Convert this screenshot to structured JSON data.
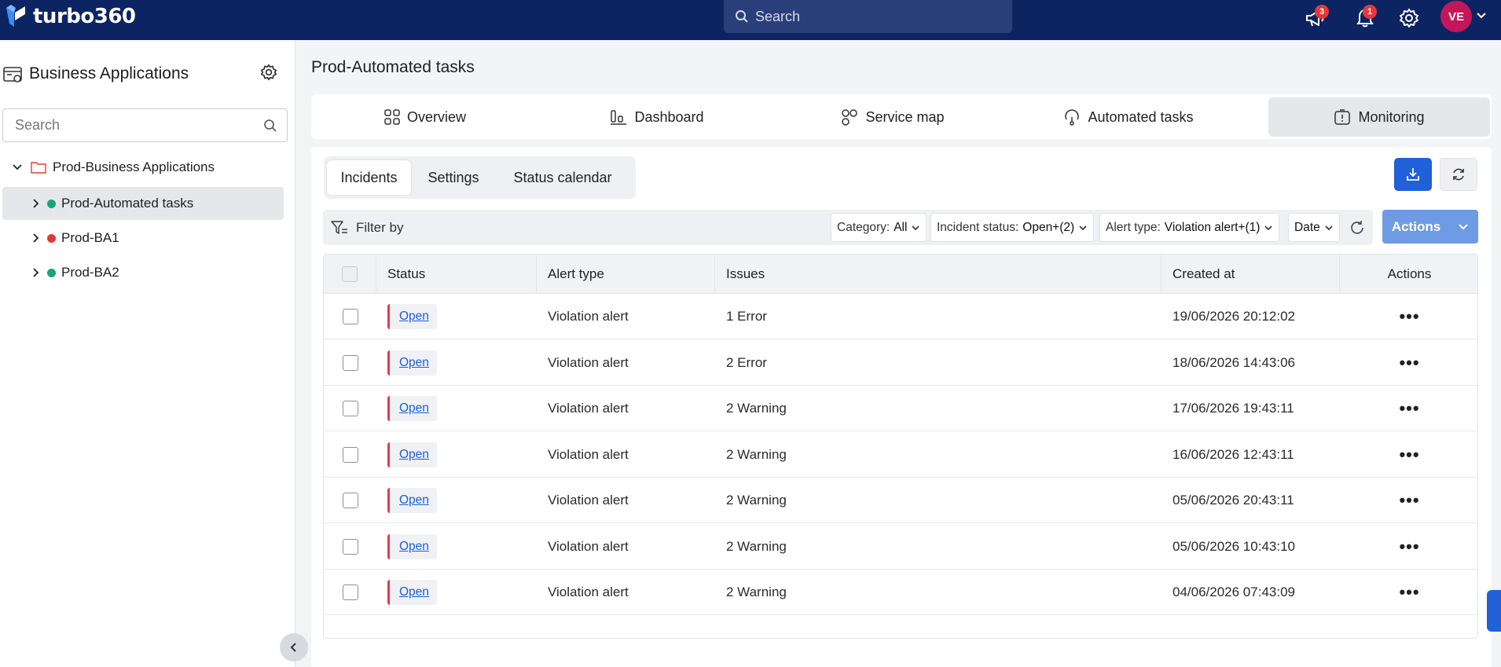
{
  "brand": {
    "name": "turbo360"
  },
  "topbar": {
    "search_placeholder": "Search",
    "announcements_count": "3",
    "notifications_count": "1",
    "user_initials": "VE"
  },
  "sidebar": {
    "title": "Business Applications",
    "search_placeholder": "Search",
    "tree": {
      "root": {
        "label": "Prod-Business Applications"
      },
      "children": [
        {
          "label": "Prod-Automated tasks",
          "status_color": "#1aa37a",
          "selected": true
        },
        {
          "label": "Prod-BA1",
          "status_color": "#e53935",
          "selected": false
        },
        {
          "label": "Prod-BA2",
          "status_color": "#1aa37a",
          "selected": false
        }
      ]
    }
  },
  "page": {
    "title": "Prod-Automated tasks"
  },
  "tabs": [
    {
      "label": "Overview",
      "icon": "grid-icon"
    },
    {
      "label": "Dashboard",
      "icon": "dashboard-icon"
    },
    {
      "label": "Service map",
      "icon": "service-map-icon"
    },
    {
      "label": "Automated tasks",
      "icon": "automated-tasks-icon"
    },
    {
      "label": "Monitoring",
      "icon": "monitoring-icon",
      "active": true
    }
  ],
  "subtabs": [
    {
      "label": "Incidents",
      "active": true
    },
    {
      "label": "Settings"
    },
    {
      "label": "Status calendar"
    }
  ],
  "filter": {
    "label": "Filter by",
    "chips": [
      {
        "key": "Category:",
        "value": "All"
      },
      {
        "key": "Incident status:",
        "value": "Open+(2)"
      },
      {
        "key": "Alert type:",
        "value": "Violation alert+(1)"
      },
      {
        "key": "",
        "value": "Date"
      }
    ]
  },
  "actions_label": "Actions",
  "table": {
    "columns": [
      "Status",
      "Alert type",
      "Issues",
      "Created at",
      "Actions"
    ],
    "rows": [
      {
        "status": "Open",
        "alert_type": "Violation alert",
        "issues": "1 Error",
        "created_at": "19/06/2026 20:12:02"
      },
      {
        "status": "Open",
        "alert_type": "Violation alert",
        "issues": "2 Error",
        "created_at": "18/06/2026 14:43:06"
      },
      {
        "status": "Open",
        "alert_type": "Violation alert",
        "issues": "2 Warning",
        "created_at": "17/06/2026 19:43:11"
      },
      {
        "status": "Open",
        "alert_type": "Violation alert",
        "issues": "2 Warning",
        "created_at": "16/06/2026 12:43:11"
      },
      {
        "status": "Open",
        "alert_type": "Violation alert",
        "issues": "2 Warning",
        "created_at": "05/06/2026 20:43:11"
      },
      {
        "status": "Open",
        "alert_type": "Violation alert",
        "issues": "2 Warning",
        "created_at": "05/06/2026 10:43:10"
      },
      {
        "status": "Open",
        "alert_type": "Violation alert",
        "issues": "2 Warning",
        "created_at": "04/06/2026 07:43:09"
      }
    ],
    "more_glyph": "•••"
  },
  "colors": {
    "topbar": "#0d2463",
    "primary": "#2060d8",
    "status_open_accent": "#e53950"
  }
}
